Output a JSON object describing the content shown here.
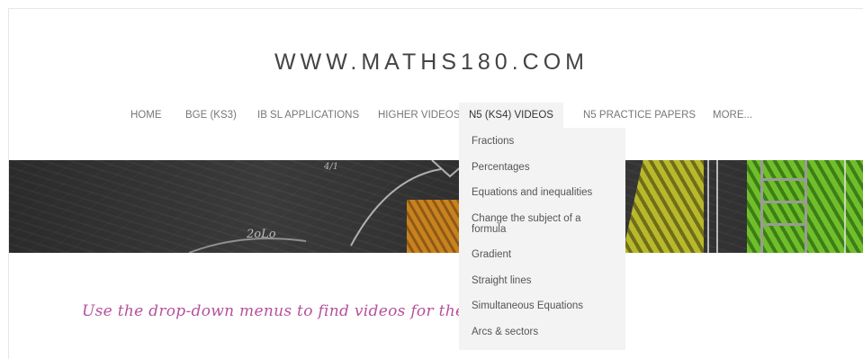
{
  "site": {
    "title": "WWW.MATHS180.COM"
  },
  "nav": {
    "items": [
      {
        "label": "HOME"
      },
      {
        "label": "BGE (KS3)"
      },
      {
        "label": "IB SL APPLICATIONS"
      },
      {
        "label": "HIGHER VIDEOS"
      },
      {
        "label": "N5 (KS4) VIDEOS"
      },
      {
        "label": "N5 PRACTICE PAPERS"
      },
      {
        "label": "MORE..."
      }
    ],
    "active": "N5 (KS4) VIDEOS"
  },
  "dropdown": {
    "items": [
      {
        "label": "Fractions"
      },
      {
        "label": "Percentages"
      },
      {
        "label": "Equations and inequalities"
      },
      {
        "label": "Change the subject of a formula"
      },
      {
        "label": "Gradient"
      },
      {
        "label": "Straight lines"
      },
      {
        "label": "Simultaneous Equations"
      },
      {
        "label": "Arcs & sectors"
      }
    ]
  },
  "banner": {
    "chalk_text": [
      "2oLo",
      "4/1"
    ]
  },
  "main": {
    "intro_text": "Use the drop-down menus to find videos for the topics"
  },
  "colors": {
    "accent_text": "#b5519b",
    "menu_bg": "#f3f3f3"
  }
}
